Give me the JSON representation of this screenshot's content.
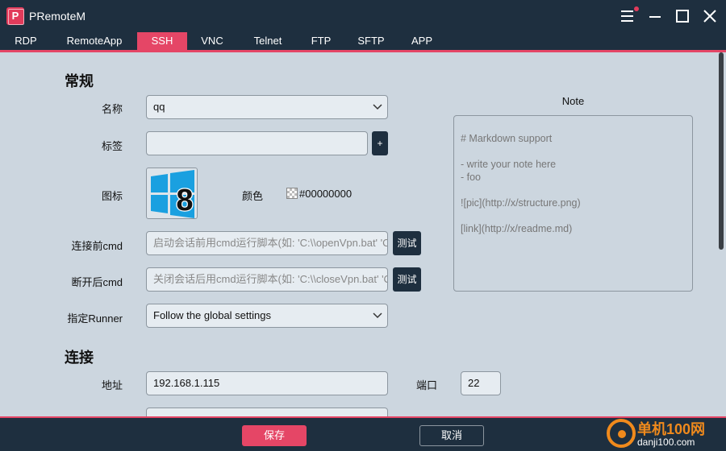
{
  "app": {
    "title": "PRemoteM",
    "logo_letter": "P"
  },
  "tabs": [
    {
      "label": "RDP"
    },
    {
      "label": "RemoteApp"
    },
    {
      "label": "SSH"
    },
    {
      "label": "VNC"
    },
    {
      "label": "Telnet"
    },
    {
      "label": "FTP"
    },
    {
      "label": "SFTP"
    },
    {
      "label": "APP"
    }
  ],
  "active_tab": "SSH",
  "general": {
    "section_title": "常规",
    "name_label": "名称",
    "name_value": "qq",
    "tags_label": "标签",
    "tags_value": "",
    "add_tag_label": "+",
    "icon_label": "图标",
    "icon_badge": "8",
    "color_label": "颜色",
    "color_value": "#00000000",
    "before_cmd_label": "连接前cmd",
    "before_cmd_placeholder": "启动会话前用cmd运行脚本(如: 'C:\\\\openVpn.bat' 'C",
    "after_cmd_label": "断开后cmd",
    "after_cmd_placeholder": "关闭会话后用cmd运行脚本(如: 'C:\\\\closeVpn.bat' 'C",
    "test_label": "测试",
    "runner_label": "指定Runner",
    "runner_value": "Follow the global settings"
  },
  "note": {
    "title": "Note",
    "lines": [
      "# Markdown support",
      "",
      "- write your note here",
      "- foo",
      "",
      "![pic](http://x/structure.png)",
      "",
      "[link](http://x/readme.md)"
    ]
  },
  "connection": {
    "section_title": "连接",
    "address_label": "地址",
    "address_value": "192.168.1.115",
    "port_label": "端口",
    "port_value": "22"
  },
  "footer": {
    "save_label": "保存",
    "cancel_label": "取消"
  },
  "watermark": {
    "line1": "单机100网",
    "line2": "danji100.com"
  },
  "colors": {
    "accent": "#e54666",
    "dark": "#1e2f3f",
    "panel": "#ccd6df",
    "win8_blue": "#1aa0e0"
  }
}
